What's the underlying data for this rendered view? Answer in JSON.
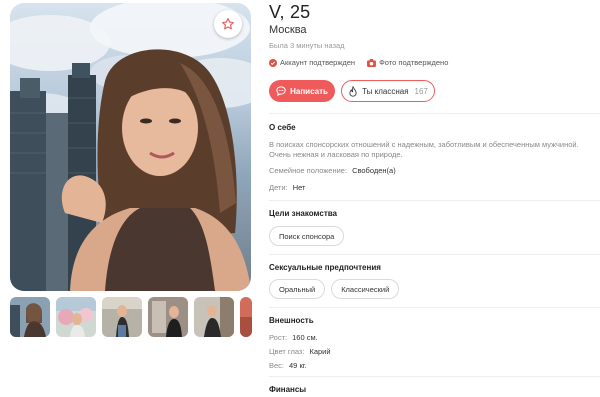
{
  "profile": {
    "name_age": "V, 25",
    "city": "Москва",
    "last_seen": "Была 3 минуты назад",
    "verified_account": "Аккаунт подтвержден",
    "verified_photo": "Фото подтверждено"
  },
  "actions": {
    "write_label": "Написать",
    "like_label": "Ты классная",
    "like_count": "167"
  },
  "about": {
    "title": "О себе",
    "text": "В поисках спонсорских отношений с надежным, заботливым и обеспеченным мужчиной. Очень нежная и ласковая по природе.",
    "marital_label": "Семейное положение:",
    "marital_value": "Свободен(а)",
    "kids_label": "Дети:",
    "kids_value": "Нет"
  },
  "goals": {
    "title": "Цели знакомства",
    "chips": [
      "Поиск спонсора"
    ]
  },
  "sexual": {
    "title": "Сексуальные предпочтения",
    "chips": [
      "Оральный",
      "Классический"
    ]
  },
  "appearance": {
    "title": "Внешность",
    "height_label": "Рост:",
    "height_value": "160 см.",
    "eyes_label": "Цвет глаз:",
    "eyes_value": "Карий",
    "weight_label": "Вес:",
    "weight_value": "49 кг."
  },
  "finance": {
    "title": "Финансы"
  },
  "colors": {
    "accent": "#ef5b5b",
    "verify_green": "#e0533f",
    "text_muted": "#888888"
  },
  "icons": {
    "favorite": "star-icon",
    "write": "chat-bubble-icon",
    "like": "flame-icon",
    "account_verified": "check-circle-icon",
    "photo_verified": "camera-icon"
  }
}
